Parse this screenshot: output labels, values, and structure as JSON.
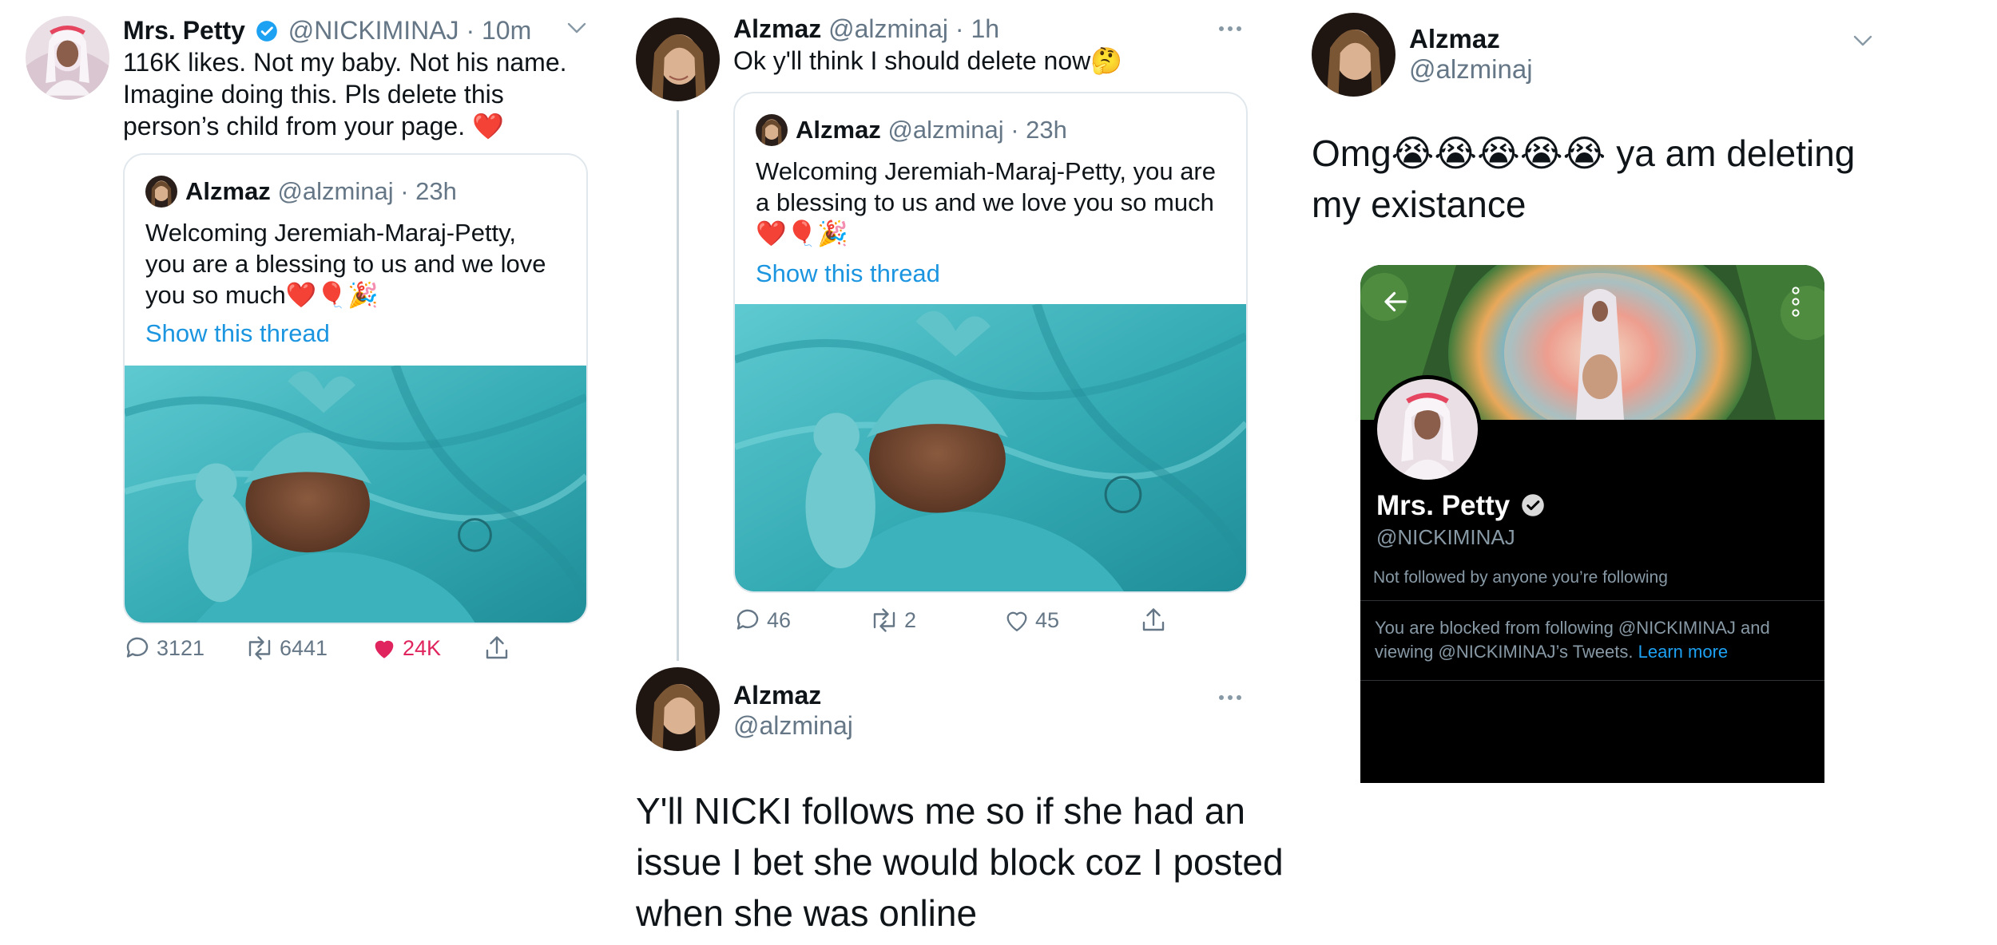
{
  "colors": {
    "accent": "#1b95e0",
    "like_active": "#e0245e",
    "verified": "#1da1f2",
    "muted": "#657786",
    "teal_blanket": "#3fb6bf"
  },
  "left_tweet": {
    "name": "Mrs. Petty",
    "verified": true,
    "handle": "@NICKIMINAJ",
    "time": "· 10m",
    "text_line1": "116K likes. Not my baby. Not his name.",
    "text_line2": "Imagine doing this. Pls delete this",
    "text_line3": "person’s child from your page. ❤️",
    "menu_icon": "chevron-down-icon",
    "quote": {
      "name": "Alzmaz",
      "handle": "@alzminaj",
      "time": "· 23h",
      "text_line1": "Welcoming Jeremiah-Maraj-Petty,",
      "text_line2": "you are a blessing to us and we love",
      "text_line3": "you so much❤️🎈🎉",
      "show_thread": "Show this thread"
    },
    "actions": {
      "replies": "3121",
      "retweets": "6441",
      "likes": "24K"
    }
  },
  "middle_tweet": {
    "name": "Alzmaz",
    "handle": "@alzminaj",
    "time": "· 1h",
    "text": "Ok y'll think I should delete now🤔",
    "menu_icon": "more-horizontal-icon",
    "quote": {
      "name": "Alzmaz",
      "handle": "@alzminaj",
      "time": "· 23h",
      "text_line1": "Welcoming Jeremiah-Maraj-Petty, you are",
      "text_line2": "a blessing to us and we love you so much",
      "text_line3": "❤️🎈🎉",
      "show_thread": "Show this thread"
    },
    "actions": {
      "replies": "46",
      "retweets": "2",
      "likes": "45"
    }
  },
  "middle_reply": {
    "name": "Alzmaz",
    "handle": "@alzminaj",
    "text_line1": "Y'll NICKI follows me so if she had an",
    "text_line2": "issue I bet she would block coz I posted",
    "text_line3": "when she was online",
    "menu_icon": "more-horizontal-icon"
  },
  "right_tweet": {
    "name": "Alzmaz",
    "handle": "@alzminaj",
    "text_line1": "Omg😭😭😭😭😭 ya am deleting",
    "text_line2": "my existance",
    "menu_icon": "chevron-down-icon"
  },
  "profile_screenshot": {
    "name": "Mrs. Petty",
    "verified": true,
    "handle": "@NICKIMINAJ",
    "followed_by": "Not followed by anyone you’re following",
    "blocked_text_1": "You are blocked from following @NICKIMINAJ and",
    "blocked_text_2": "viewing @NICKIMINAJ’s Tweets.",
    "learn_more": "Learn more",
    "back_icon": "arrow-left-icon",
    "more_icon": "more-vertical-icon"
  }
}
